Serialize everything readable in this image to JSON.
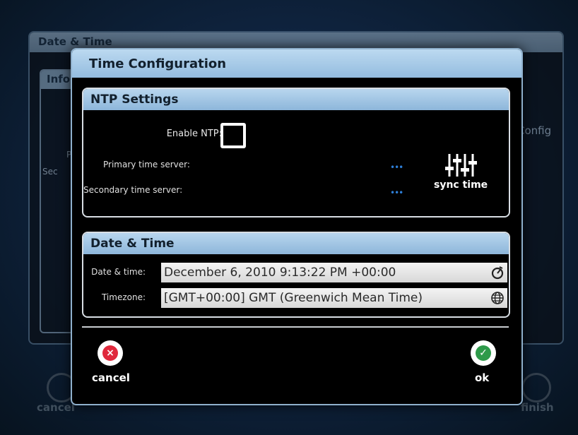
{
  "background_window": {
    "title": "Date & Time",
    "panel_title": "Info",
    "config_label": "Config",
    "label_primary": "P",
    "label_secondary": "Sec",
    "cancel_label": "cancel",
    "finish_label": "finish"
  },
  "dialog": {
    "title": "Time Configuration",
    "ntp": {
      "title": "NTP Settings",
      "enable_label": "Enable NTP:",
      "enabled": false,
      "primary_label": "Primary time server:",
      "secondary_label": "Secondary time server:",
      "more_icon": "•••",
      "sync_label": "sync time",
      "sync_icon": "sliders-icon"
    },
    "date_time": {
      "title": "Date & Time",
      "date_label": "Date & time:",
      "date_value": "December 6, 2010 9:13:22 PM +00:00",
      "date_icon": "stopwatch-icon",
      "timezone_label": "Timezone:",
      "timezone_value": "[GMT+00:00]  GMT  (Greenwich Mean Time)",
      "timezone_icon": "globe-icon"
    },
    "actions": {
      "cancel_label": "cancel",
      "ok_label": "ok"
    }
  },
  "colors": {
    "header_blue": "#94bcdf",
    "cancel_red": "#e0283c",
    "ok_green": "#2e9a4a",
    "more_blue": "#2e7fd8"
  }
}
